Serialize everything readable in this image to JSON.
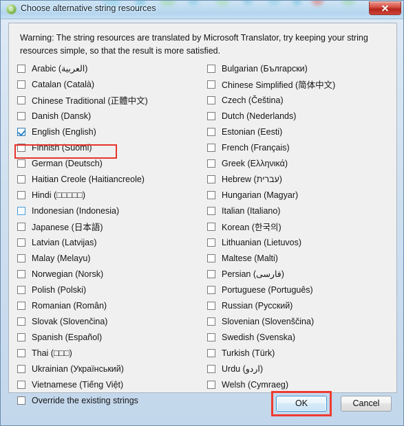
{
  "window": {
    "title": "Choose alternative string resources",
    "icon": "app-globe-icon",
    "close_label": "close-icon"
  },
  "warning": {
    "text": "Warning: The string resources are translated by Microsoft Translator, try keeping your string resources simple, so that the result is more satisfied."
  },
  "colors": {
    "accent_blue": "#2f86c8",
    "annotation_red": "#ef3b30",
    "panel_bg": "#f0f0f0",
    "titlebar_top": "#cfe4f4",
    "close_red": "#b4251b"
  },
  "columns": [
    {
      "items": [
        {
          "label": "Arabic (العربية)",
          "checked": false,
          "hover": false
        },
        {
          "label": "Catalan (Català)",
          "checked": false,
          "hover": false
        },
        {
          "label": "Chinese Traditional (正體中文)",
          "checked": false,
          "hover": false
        },
        {
          "label": "Danish (Dansk)",
          "checked": false,
          "hover": false
        },
        {
          "label": "English (English)",
          "checked": true,
          "hover": false
        },
        {
          "label": "Finnish (Suomi)",
          "checked": false,
          "hover": false
        },
        {
          "label": "German (Deutsch)",
          "checked": false,
          "hover": false
        },
        {
          "label": "Haitian Creole (Haitiancreole)",
          "checked": false,
          "hover": false
        },
        {
          "label": "Hindi (□□□□□)",
          "checked": false,
          "hover": false
        },
        {
          "label": "Indonesian (Indonesia)",
          "checked": false,
          "hover": true
        },
        {
          "label": "Japanese (日本語)",
          "checked": false,
          "hover": false
        },
        {
          "label": "Latvian (Latvijas)",
          "checked": false,
          "hover": false
        },
        {
          "label": "Malay (Melayu)",
          "checked": false,
          "hover": false
        },
        {
          "label": "Norwegian (Norsk)",
          "checked": false,
          "hover": false
        },
        {
          "label": "Polish (Polski)",
          "checked": false,
          "hover": false
        },
        {
          "label": "Romanian (Român)",
          "checked": false,
          "hover": false
        },
        {
          "label": "Slovak (Slovenčina)",
          "checked": false,
          "hover": false
        },
        {
          "label": "Spanish (Español)",
          "checked": false,
          "hover": false
        },
        {
          "label": "Thai (□□□)",
          "checked": false,
          "hover": false
        },
        {
          "label": "Ukrainian (Український)",
          "checked": false,
          "hover": false
        },
        {
          "label": "Vietnamese (Tiếng Việt)",
          "checked": false,
          "hover": false
        },
        {
          "label": "Override the existing strings",
          "checked": false,
          "hover": false
        }
      ]
    },
    {
      "items": [
        {
          "label": "Bulgarian (Български)",
          "checked": false,
          "hover": false
        },
        {
          "label": "Chinese Simplified (简体中文)",
          "checked": false,
          "hover": false
        },
        {
          "label": "Czech (Čeština)",
          "checked": false,
          "hover": false
        },
        {
          "label": "Dutch (Nederlands)",
          "checked": false,
          "hover": false
        },
        {
          "label": "Estonian (Eesti)",
          "checked": false,
          "hover": false
        },
        {
          "label": "French (Français)",
          "checked": false,
          "hover": false
        },
        {
          "label": "Greek (Ελληνικά)",
          "checked": false,
          "hover": false
        },
        {
          "label": "Hebrew (עברית)",
          "checked": false,
          "hover": false
        },
        {
          "label": "Hungarian (Magyar)",
          "checked": false,
          "hover": false
        },
        {
          "label": "Italian (Italiano)",
          "checked": false,
          "hover": false
        },
        {
          "label": "Korean (한국의)",
          "checked": false,
          "hover": false
        },
        {
          "label": "Lithuanian (Lietuvos)",
          "checked": false,
          "hover": false
        },
        {
          "label": "Maltese (Malti)",
          "checked": false,
          "hover": false
        },
        {
          "label": "Persian (فارسی)",
          "checked": false,
          "hover": false
        },
        {
          "label": "Portuguese (Português)",
          "checked": false,
          "hover": false
        },
        {
          "label": "Russian (Русский)",
          "checked": false,
          "hover": false
        },
        {
          "label": "Slovenian (Slovenščina)",
          "checked": false,
          "hover": false
        },
        {
          "label": "Swedish (Svenska)",
          "checked": false,
          "hover": false
        },
        {
          "label": "Turkish (Türk)",
          "checked": false,
          "hover": false
        },
        {
          "label": "Urdu (اردو)",
          "checked": false,
          "hover": false
        },
        {
          "label": "Welsh (Cymraeg)",
          "checked": false,
          "hover": false
        }
      ]
    }
  ],
  "buttons": {
    "ok": "OK",
    "cancel": "Cancel"
  },
  "annotations": {
    "english_row": "highlight-english-row",
    "ok_button": "highlight-ok-button"
  }
}
